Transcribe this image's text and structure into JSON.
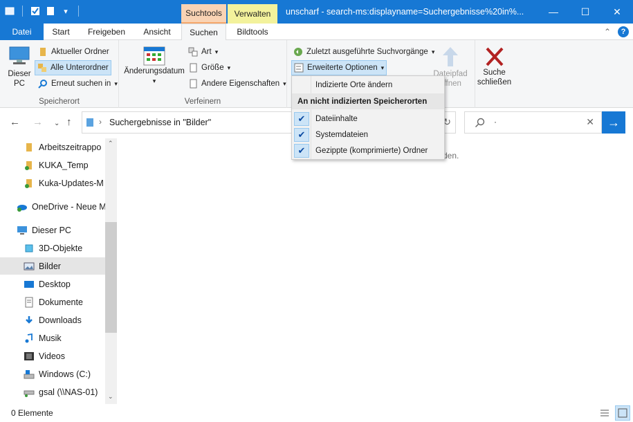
{
  "window": {
    "title": "unscharf - search-ms:displayname=Suchergebnisse%20in%...",
    "context_tabs": {
      "suchtools": "Suchtools",
      "verwalten": "Verwalten"
    }
  },
  "tabs": {
    "datei": "Datei",
    "start": "Start",
    "freigeben": "Freigeben",
    "ansicht": "Ansicht",
    "suchen": "Suchen",
    "bildtools": "Bildtools"
  },
  "ribbon": {
    "speicherort": {
      "label": "Speicherort",
      "dieser_pc": "Dieser PC",
      "aktueller_ordner": "Aktueller Ordner",
      "alle_unterordner": "Alle Unterordner",
      "erneut_suchen": "Erneut suchen in"
    },
    "verfeinern": {
      "label": "Verfeinern",
      "aenderungsdatum": "Änderungsdatum",
      "art": "Art",
      "groesse": "Größe",
      "andere_eigenschaften": "Andere Eigenschaften"
    },
    "optionen": {
      "zuletzt": "Zuletzt ausgeführte Suchvorgänge",
      "erweiterte": "Erweiterte Optionen",
      "dateipfad": "Dateipfad",
      "oeffnen": "öffnen",
      "suche": "Suche",
      "schliessen": "schließen"
    }
  },
  "menu": {
    "indizierte_orte": "Indizierte Orte ändern",
    "header": "An nicht indizierten Speicherorten",
    "items": [
      {
        "label": "Dateiinhalte",
        "checked": true
      },
      {
        "label": "Systemdateien",
        "checked": true
      },
      {
        "label": "Gezippte (komprimierte) Ordner",
        "checked": true
      }
    ]
  },
  "address": {
    "path": "Suchergebnisse in \"Bilder\"",
    "search_value": "·"
  },
  "nav": {
    "items": [
      {
        "label": "Arbeitszeitrappo",
        "icon": "folder-icon"
      },
      {
        "label": "KUKA_Temp",
        "icon": "folder-sync-icon"
      },
      {
        "label": "Kuka-Updates-M",
        "icon": "folder-sync-icon"
      },
      {
        "label": "OneDrive - Neue M",
        "icon": "onedrive-icon"
      },
      {
        "label": "Dieser PC",
        "icon": "computer-icon"
      },
      {
        "label": "3D-Objekte",
        "icon": "3d-objects-icon"
      },
      {
        "label": "Bilder",
        "icon": "pictures-icon"
      },
      {
        "label": "Desktop",
        "icon": "desktop-icon"
      },
      {
        "label": "Dokumente",
        "icon": "documents-icon"
      },
      {
        "label": "Downloads",
        "icon": "downloads-icon"
      },
      {
        "label": "Musik",
        "icon": "music-icon"
      },
      {
        "label": "Videos",
        "icon": "videos-icon"
      },
      {
        "label": "Windows (C:)",
        "icon": "drive-icon"
      },
      {
        "label": "gsal (\\\\NAS-01)",
        "icon": "network-drive-icon"
      }
    ]
  },
  "content": {
    "empty_fragment": "den."
  },
  "status": {
    "count": "0 Elemente"
  },
  "colors": {
    "accent": "#1778d4",
    "suchtools": "#f9d3b4",
    "verwalten": "#f3f29c"
  }
}
